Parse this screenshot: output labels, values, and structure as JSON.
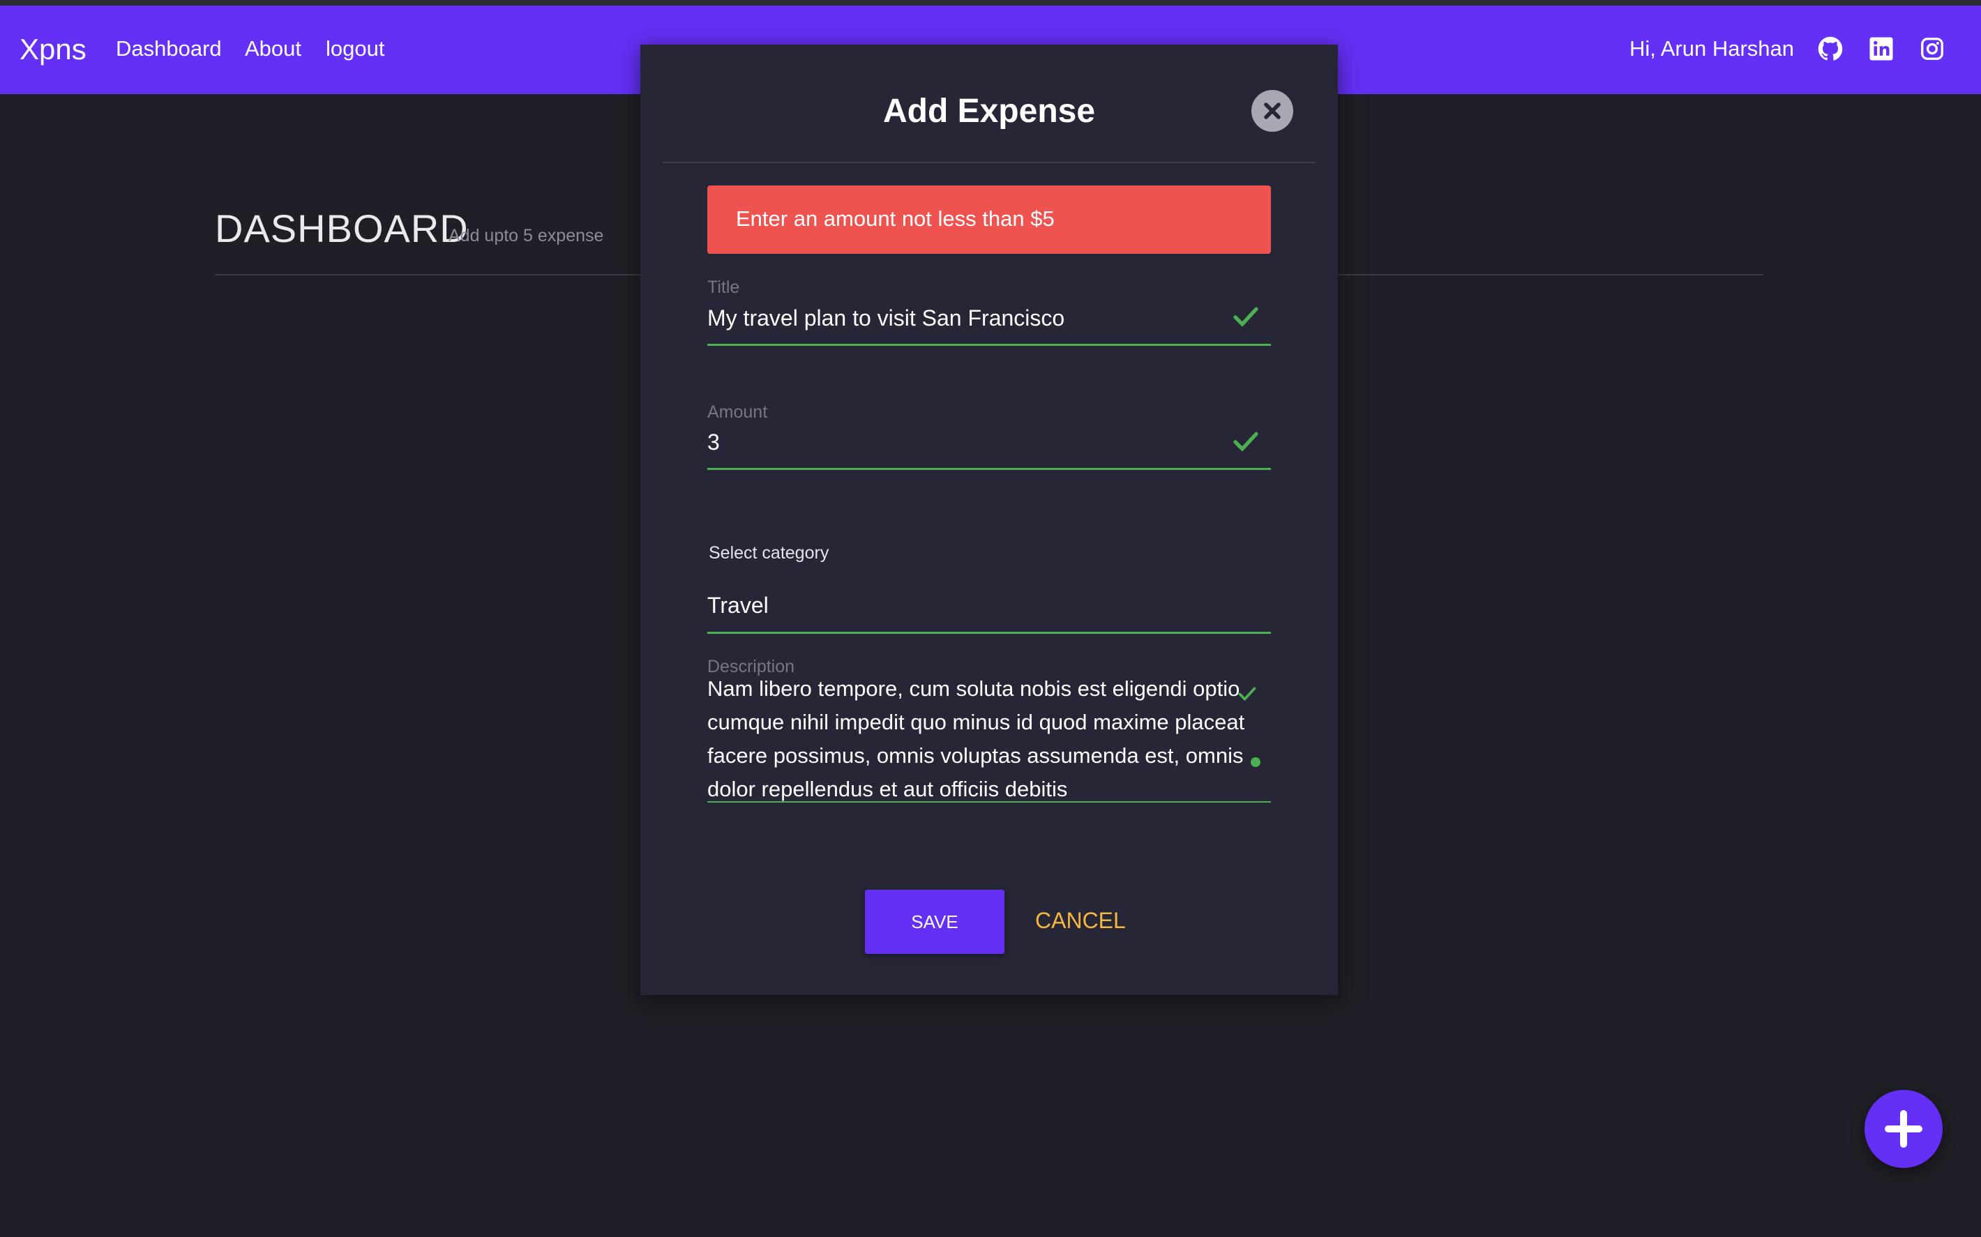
{
  "colors": {
    "primary": "#6430f6",
    "background": "#1f1f27",
    "modal": "#262637",
    "error": "#ef5350",
    "success": "#4caf50",
    "cancel": "#f4b740"
  },
  "navbar": {
    "brand": "Xpns",
    "links": [
      "Dashboard",
      "About",
      "logout"
    ],
    "greeting": "Hi, Arun Harshan",
    "social_icons": [
      "github-icon",
      "linkedin-icon",
      "instagram-icon"
    ]
  },
  "dashboard": {
    "title": "DASHBOARD",
    "subtitle": "Add upto 5 expense"
  },
  "modal": {
    "title": "Add Expense",
    "alert": "Enter an amount not less than $5",
    "fields": {
      "title_label": "Title",
      "title_value": "My travel plan to visit San Francisco",
      "amount_label": "Amount",
      "amount_value": "3",
      "category_label": "Select category",
      "category_value": "Travel",
      "description_label": "Description",
      "description_value": "Nam libero tempore, cum soluta nobis est eligendi optio cumque nihil impedit quo minus id quod maxime placeat facere possimus, omnis voluptas assumenda est, omnis dolor repellendus et aut officiis debitis"
    },
    "save_label": "SAVE",
    "cancel_label": "CANCEL"
  }
}
